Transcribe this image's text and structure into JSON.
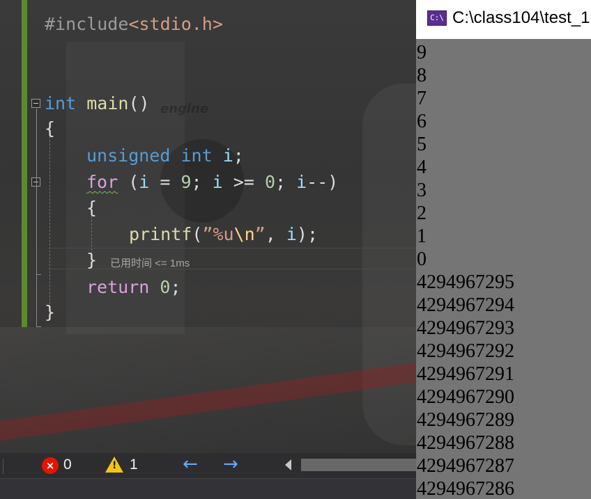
{
  "editor": {
    "include": {
      "directive": "#include",
      "open": "<",
      "header": "stdio.h",
      "close": ">"
    },
    "main_sig": {
      "type": "int",
      "name": "main",
      "parens": "()"
    },
    "open_brace": "{",
    "decl": {
      "kw1": "unsigned",
      "kw2": "int",
      "var": "i",
      "semi": ";"
    },
    "for_line": {
      "kw": "for",
      "p1": " (",
      "v1": "i",
      "op1": " = ",
      "n1": "9",
      "s1": "; ",
      "v2": "i",
      "op2": " >= ",
      "n2": "0",
      "s2": "; ",
      "v3": "i",
      "op3": "--",
      "p2": ")"
    },
    "inner_open": "{",
    "printf_line": {
      "fn": "printf",
      "p1": "(",
      "q1": "”",
      "fmt": "%u",
      "esc": "\\n",
      "q2": "”",
      "comma": ", ",
      "arg": "i",
      "end": ");"
    },
    "inner_close": "}",
    "elapsed": "已用时间 <= 1ms",
    "return_line": {
      "kw": "return",
      "sp": " ",
      "num": "0",
      "semi": ";"
    },
    "close_brace": "}"
  },
  "status": {
    "errors": "0",
    "warnings": "1",
    "error_icon": "×",
    "warning_icon": "!",
    "nav_back": "←",
    "nav_forward": "→"
  },
  "console": {
    "icon": "C:\\",
    "title": "C:\\class104\\test_1",
    "output": [
      "9",
      "8",
      "7",
      "6",
      "5",
      "4",
      "3",
      "2",
      "1",
      "0",
      "4294967295",
      "4294967294",
      "4294967293",
      "4294967292",
      "4294967291",
      "4294967290",
      "4294967289",
      "4294967288",
      "4294967287",
      "4294967286"
    ]
  }
}
